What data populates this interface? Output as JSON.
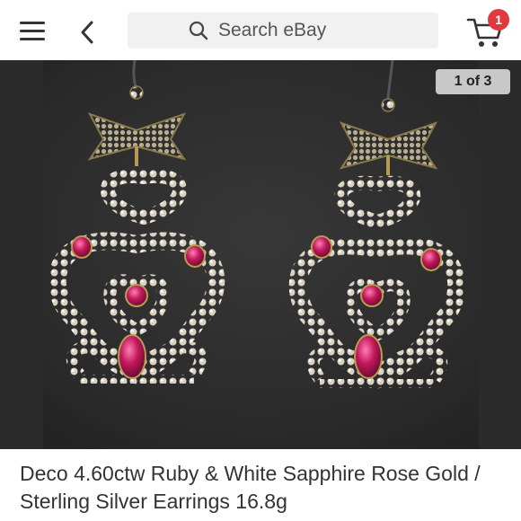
{
  "header": {
    "search_placeholder": "Search eBay",
    "cart_count": "1",
    "icons": {
      "menu": "hamburger-menu-icon",
      "back": "chevron-left-icon",
      "search": "search-icon",
      "cart": "cart-icon"
    }
  },
  "gallery": {
    "counter": "1 of 3",
    "image_alt": "Ruby and white sapphire drop earrings on black velvet display"
  },
  "listing": {
    "title": "Deco 4.60ctw Ruby & White Sapphire Rose Gold / Sterling Silver Earrings 16.8g"
  },
  "colors": {
    "badge": "#e0393e",
    "search_bg": "#f1f1f1",
    "counter_bg": "#c8c8c8",
    "ruby": "#c2185b"
  }
}
